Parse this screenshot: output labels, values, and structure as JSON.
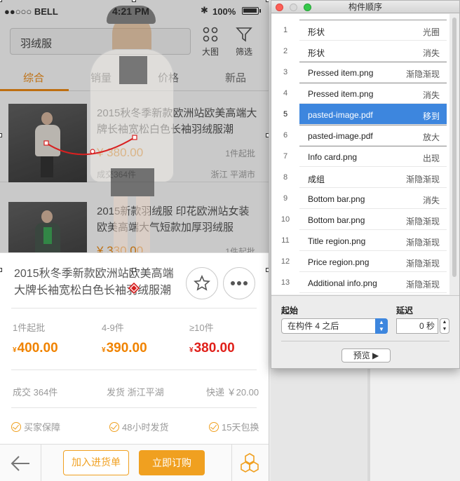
{
  "status_bar": {
    "carrier": "●●○○○ BELL",
    "time": "4:21 PM",
    "bluetooth": "✱",
    "battery_pct": "100%",
    "battery_level": 1.0
  },
  "search": {
    "value": "羽绒服"
  },
  "top_icons": [
    {
      "label": "大图",
      "icon": "grid-icon"
    },
    {
      "label": "筛选",
      "icon": "filter-icon"
    }
  ],
  "sort_tabs": [
    {
      "label": "综合",
      "active": true
    },
    {
      "label": "销量"
    },
    {
      "label": "价格"
    },
    {
      "label": "新品"
    }
  ],
  "products": [
    {
      "title": "2015秋冬季新款欧洲站欧美高端大牌长袖宽松白色长袖羽绒服潮",
      "price": "¥ 380.00",
      "moq": "1件起批",
      "deals": "成交364件",
      "location": "浙江 平湖市"
    },
    {
      "title": "2015新款羽绒服 印花欧洲站女装欧美高端大气短款加厚羽绒服",
      "price": "¥ 330.00",
      "moq": "1件起批"
    }
  ],
  "detail": {
    "title": "2015秋冬季新款欧洲站欧美高端大牌长袖宽松白色长袖羽绒服潮",
    "tiers": [
      {
        "label": "1件起批",
        "currency": "¥",
        "price": "400.00",
        "color": "#f08300"
      },
      {
        "label": "4-9件",
        "currency": "¥",
        "price": "390.00",
        "color": "#f08300"
      },
      {
        "label": "≥10件",
        "currency": "¥",
        "price": "380.00",
        "color": "#e0201a"
      }
    ],
    "stats": {
      "deals": "成交 364件",
      "ship_from": "发货 浙江平湖",
      "express": "快递 ￥20.00"
    },
    "guarantees": [
      "买家保障",
      "48小时发货",
      "15天包换"
    ],
    "buttons": {
      "add_to_cart": "加入进货单",
      "order_now": "立即订购"
    }
  },
  "panel": {
    "title": "构件顺序",
    "rows": [
      {
        "num": "1",
        "name": "形状",
        "effect": "光圈"
      },
      {
        "num": "2",
        "name": "形状",
        "effect": "消失"
      },
      {
        "num": "3",
        "name": "Pressed item.png",
        "effect": "渐隐渐现"
      },
      {
        "num": "4",
        "name": "Pressed item.png",
        "effect": "消失"
      },
      {
        "num": "5",
        "name": "pasted-image.pdf",
        "effect": "移到",
        "selected": true
      },
      {
        "num": "6",
        "name": "pasted-image.pdf",
        "effect": "放大"
      },
      {
        "num": "7",
        "name": "Info card.png",
        "effect": "出现"
      },
      {
        "num": "8",
        "name": "成组",
        "effect": "渐隐渐现"
      },
      {
        "num": "9",
        "name": "Bottom bar.png",
        "effect": "消失"
      },
      {
        "num": "10",
        "name": "Bottom bar.png",
        "effect": "渐隐渐现"
      },
      {
        "num": "11",
        "name": "Title region.png",
        "effect": "渐隐渐现"
      },
      {
        "num": "12",
        "name": "Price region.png",
        "effect": "渐隐渐现"
      },
      {
        "num": "13",
        "name": "Additional info.png",
        "effect": "渐隐渐现"
      }
    ],
    "start_label": "起始",
    "start_value": "在构件 4 之后",
    "delay_label": "延迟",
    "delay_value": "0 秒",
    "preview_label": "预览 ▶"
  },
  "colors": {
    "accent_orange": "#f08300",
    "price_red": "#e0201a",
    "selection_blue": "#3d86de"
  }
}
